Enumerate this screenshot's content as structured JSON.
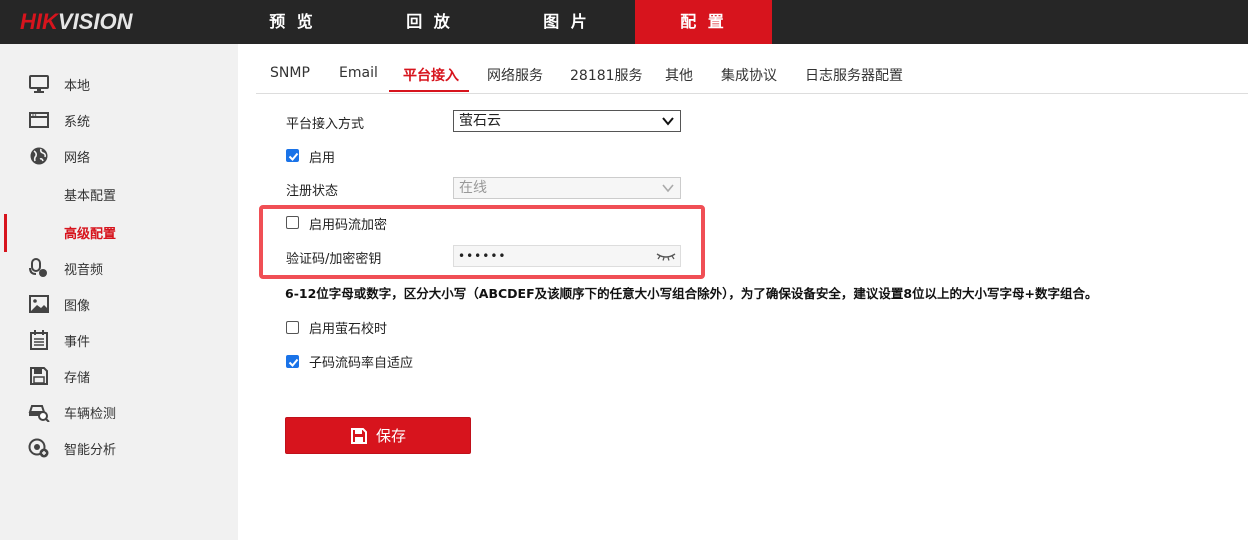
{
  "brand": {
    "name_red": "HIK",
    "name_white": "VISION"
  },
  "topnav": [
    {
      "label": "预 览",
      "active": false
    },
    {
      "label": "回 放",
      "active": false
    },
    {
      "label": "图 片",
      "active": false
    },
    {
      "label": "配 置",
      "active": true
    }
  ],
  "sidebar": {
    "items": [
      {
        "label": "本地",
        "icon": "monitor-icon"
      },
      {
        "label": "系统",
        "icon": "system-window-icon"
      },
      {
        "label": "网络",
        "icon": "globe-icon"
      },
      {
        "label": "基本配置",
        "sub": true
      },
      {
        "label": "高级配置",
        "sub": true,
        "active": true
      },
      {
        "label": "视音频",
        "icon": "video-audio-icon"
      },
      {
        "label": "图像",
        "icon": "image-icon"
      },
      {
        "label": "事件",
        "icon": "calendar-icon"
      },
      {
        "label": "存储",
        "icon": "floppy-icon"
      },
      {
        "label": "车辆检测",
        "icon": "vehicle-detect-icon"
      },
      {
        "label": "智能分析",
        "icon": "smart-analysis-icon"
      }
    ]
  },
  "tabs": [
    {
      "label": "SNMP"
    },
    {
      "label": "Email"
    },
    {
      "label": "平台接入",
      "active": true
    },
    {
      "label": "网络服务"
    },
    {
      "label": "28181服务"
    },
    {
      "label": "其他"
    },
    {
      "label": "集成协议"
    },
    {
      "label": "日志服务器配置"
    }
  ],
  "form": {
    "access_mode_label": "平台接入方式",
    "access_mode_value": "萤石云",
    "enable_label": "启用",
    "enable_checked": true,
    "reg_status_label": "注册状态",
    "reg_status_value": "在线",
    "stream_encrypt_label": "启用码流加密",
    "stream_encrypt_checked": false,
    "verify_code_label": "验证码/加密密钥",
    "verify_code_value": "••••••",
    "hint": "6-12位字母或数字，区分大小写（ABCDEF及该顺序下的任意大小写组合除外），为了确保设备安全，建议设置8位以上的大小写字母+数字组合。",
    "ezviz_time_label": "启用萤石校时",
    "ezviz_time_checked": false,
    "substream_adaptive_label": "子码流码率自适应",
    "substream_adaptive_checked": true
  },
  "save_label": "保存",
  "colors": {
    "accent": "#d7141d",
    "topbar": "#262626",
    "sidebar": "#f1f1f1",
    "checkbox": "#1a73e8",
    "highlight": "#f04f55"
  }
}
